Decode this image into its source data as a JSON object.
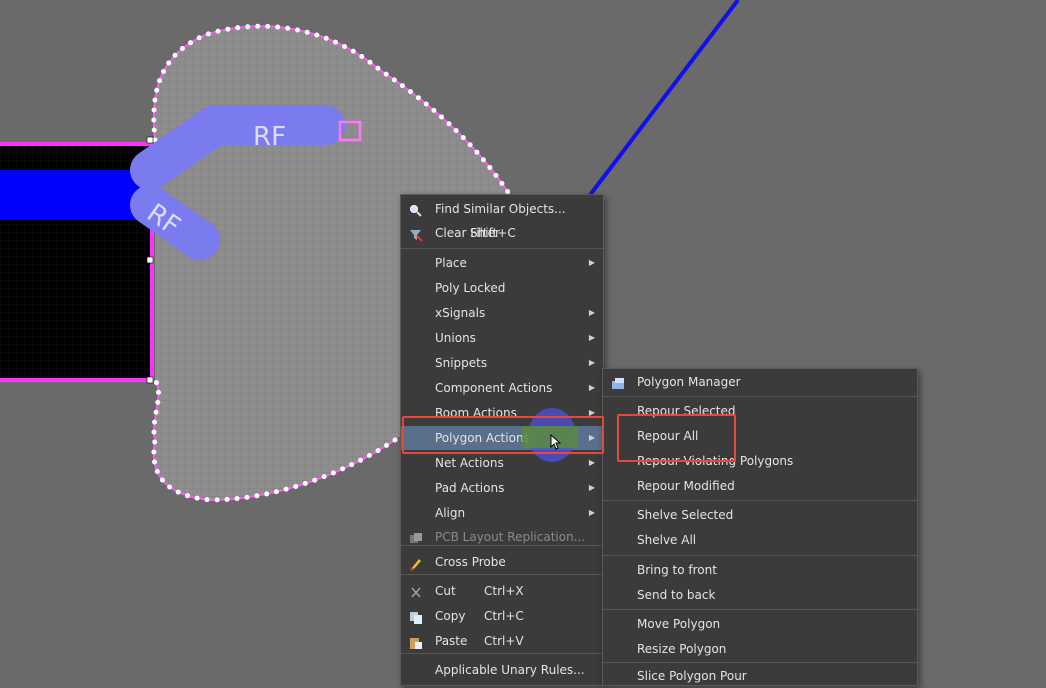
{
  "canvas": {
    "labels": [
      "RF",
      "RF"
    ],
    "colors": {
      "background": "#6a6a6a",
      "polygon": "#7b7bdc",
      "trace": "#0000ff",
      "outline": "#ff33ff",
      "board": "#000000"
    }
  },
  "context_menu": {
    "items": [
      {
        "label": "Find Similar Objects...",
        "icon": "magnifier-icon"
      },
      {
        "label": "Clear Filter",
        "shortcut": "Shift+C",
        "icon": "clear-filter-icon"
      },
      {
        "label": "Place",
        "submenu": true
      },
      {
        "label": "Poly Locked"
      },
      {
        "label": "xSignals",
        "submenu": true
      },
      {
        "label": "Unions",
        "submenu": true
      },
      {
        "label": "Snippets",
        "submenu": true
      },
      {
        "label": "Component Actions",
        "submenu": true
      },
      {
        "label": "Room Actions",
        "submenu": true
      },
      {
        "label": "Polygon Actions",
        "submenu": true,
        "highlighted": true
      },
      {
        "label": "Net Actions",
        "submenu": true
      },
      {
        "label": "Pad Actions",
        "submenu": true
      },
      {
        "label": "Align",
        "submenu": true
      },
      {
        "label": "PCB Layout Replication...",
        "disabled": true,
        "icon": "replication-icon"
      },
      {
        "label": "Cross Probe",
        "icon": "cross-probe-icon"
      },
      {
        "label": "Cut",
        "shortcut": "Ctrl+X",
        "icon": "scissors-icon"
      },
      {
        "label": "Copy",
        "shortcut": "Ctrl+C",
        "icon": "copy-icon"
      },
      {
        "label": "Paste",
        "shortcut": "Ctrl+V",
        "icon": "paste-icon"
      },
      {
        "label": "Applicable Unary Rules..."
      }
    ]
  },
  "submenu": {
    "items": [
      {
        "label": "Polygon Manager",
        "icon": "polygon-manager-icon"
      },
      {
        "label": "Repour Selected"
      },
      {
        "label": "Repour All"
      },
      {
        "label": "Repour Violating Polygons"
      },
      {
        "label": "Repour Modified"
      },
      {
        "label": "Shelve Selected"
      },
      {
        "label": "Shelve All"
      },
      {
        "label": "Bring to front"
      },
      {
        "label": "Send to back"
      },
      {
        "label": "Move Polygon"
      },
      {
        "label": "Resize Polygon"
      },
      {
        "label": "Slice Polygon Pour"
      }
    ]
  }
}
